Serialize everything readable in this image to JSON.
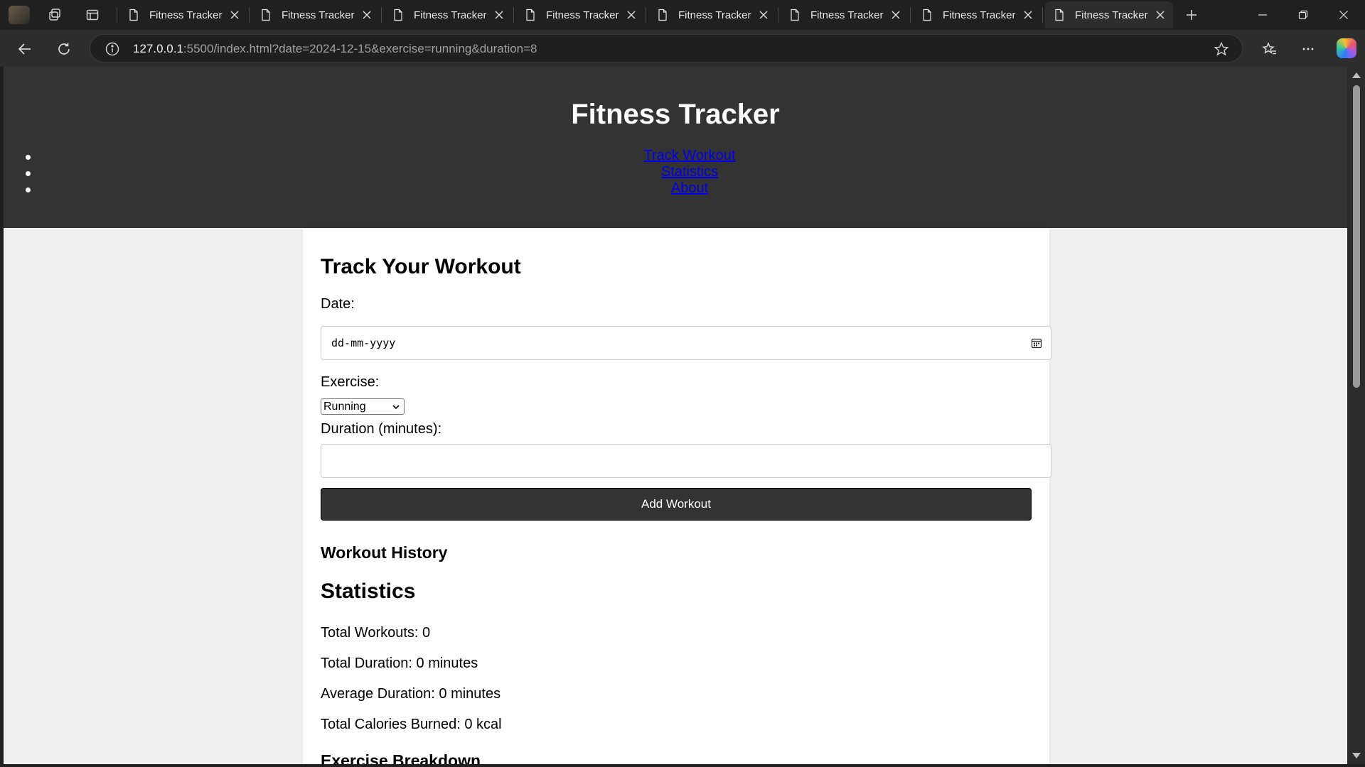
{
  "browser": {
    "tabs": [
      {
        "title": "Fitness Tracker",
        "active": false
      },
      {
        "title": "Fitness Tracker",
        "active": false
      },
      {
        "title": "Fitness Tracker",
        "active": false
      },
      {
        "title": "Fitness Tracker",
        "active": false
      },
      {
        "title": "Fitness Tracker",
        "active": false
      },
      {
        "title": "Fitness Tracker",
        "active": false
      },
      {
        "title": "Fitness Tracker",
        "active": false
      },
      {
        "title": "Fitness Tracker",
        "active": true
      }
    ],
    "url_host": "127.0.0.1",
    "url_rest": ":5500/index.html?date=2024-12-15&exercise=running&duration=8"
  },
  "site": {
    "title": "Fitness Tracker",
    "nav": [
      "Track Workout",
      "Statistics",
      "About"
    ]
  },
  "form": {
    "heading": "Track Your Workout",
    "date_label": "Date:",
    "date_placeholder": "dd-mm-yyyy",
    "exercise_label": "Exercise:",
    "exercise_value": "Running",
    "duration_label": "Duration (minutes):",
    "duration_value": "",
    "add_button": "Add Workout"
  },
  "history": {
    "heading": "Workout History"
  },
  "statistics": {
    "heading": "Statistics",
    "total_workouts": "Total Workouts: 0",
    "total_duration": "Total Duration: 0 minutes",
    "average_duration": "Average Duration: 0 minutes",
    "total_calories": "Total Calories Burned: 0 kcal"
  },
  "breakdown": {
    "heading": "Exercise Breakdown"
  }
}
